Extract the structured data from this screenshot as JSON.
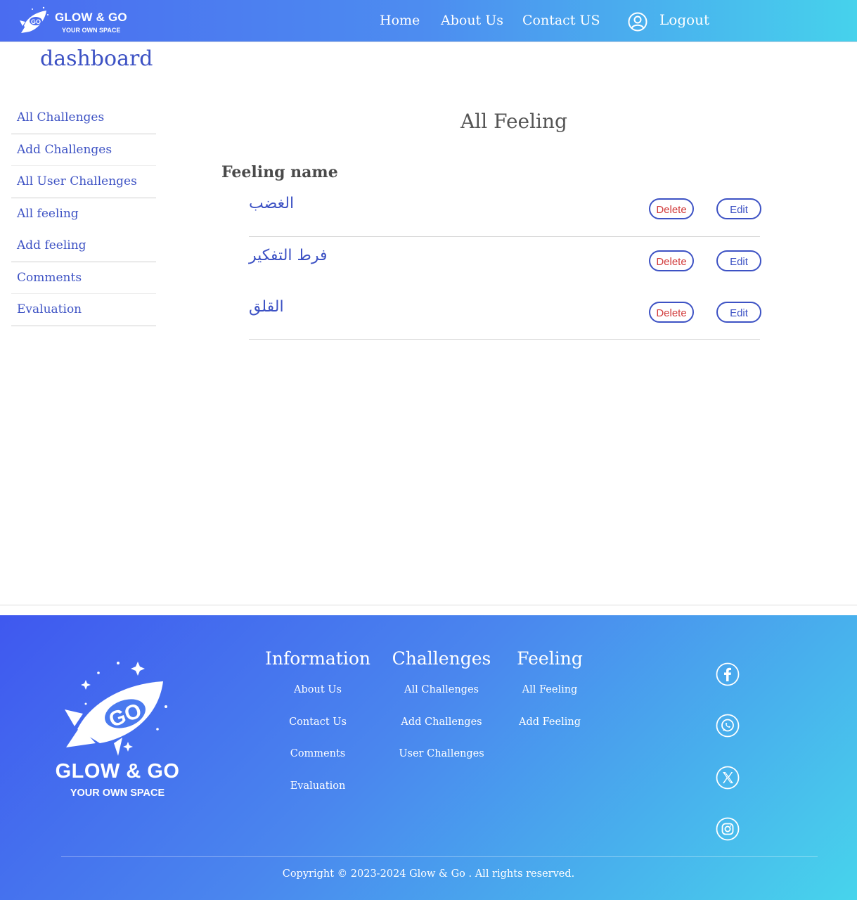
{
  "header": {
    "brand": "GLOW & GO",
    "tagline": "YOUR OWN SPACE",
    "logo_icon": "rocket-icon",
    "nav": [
      {
        "label": "Home"
      },
      {
        "label": "About Us"
      },
      {
        "label": "Contact US"
      }
    ],
    "user_icon": "user-circle-icon",
    "logout_label": "Logout"
  },
  "dashboard_title": "dashboard",
  "sidebar": {
    "items": [
      {
        "label": "All Challenges"
      },
      {
        "label": "Add Challenges"
      },
      {
        "label": "All User Challenges"
      },
      {
        "label": "All feeling"
      },
      {
        "label": "Add feeling"
      },
      {
        "label": "Comments"
      },
      {
        "label": "Evaluation"
      }
    ]
  },
  "main": {
    "title": "All Feeling",
    "column_header": "Feeling name",
    "rows": [
      {
        "name": "الغضب",
        "delete_label": "Delete",
        "edit_label": "Edit"
      },
      {
        "name": "فرط التفكير",
        "delete_label": "Delete",
        "edit_label": "Edit"
      },
      {
        "name": "القلق",
        "delete_label": "Delete",
        "edit_label": "Edit"
      }
    ]
  },
  "footer": {
    "brand": "GLOW & GO",
    "tagline": "YOUR OWN SPACE",
    "columns": [
      {
        "heading": "Information",
        "links": [
          "About Us",
          "Contact Us",
          "Comments",
          "Evaluation"
        ]
      },
      {
        "heading": "Challenges",
        "links": [
          "All Challenges",
          "Add Challenges",
          "User Challenges"
        ]
      },
      {
        "heading": "Feeling",
        "links": [
          "All Feeling",
          "Add Feeling"
        ]
      }
    ],
    "social_icons": [
      "facebook-icon",
      "whatsapp-icon",
      "x-twitter-icon",
      "instagram-icon"
    ],
    "copyright": "Copyright © 2023-2024 Glow & Go . All rights reserved."
  },
  "colors": {
    "accent": "#3d52c4",
    "delete": "#d13a3a",
    "gradient_start": "#4a6cf0",
    "gradient_end": "#46d2ec"
  }
}
